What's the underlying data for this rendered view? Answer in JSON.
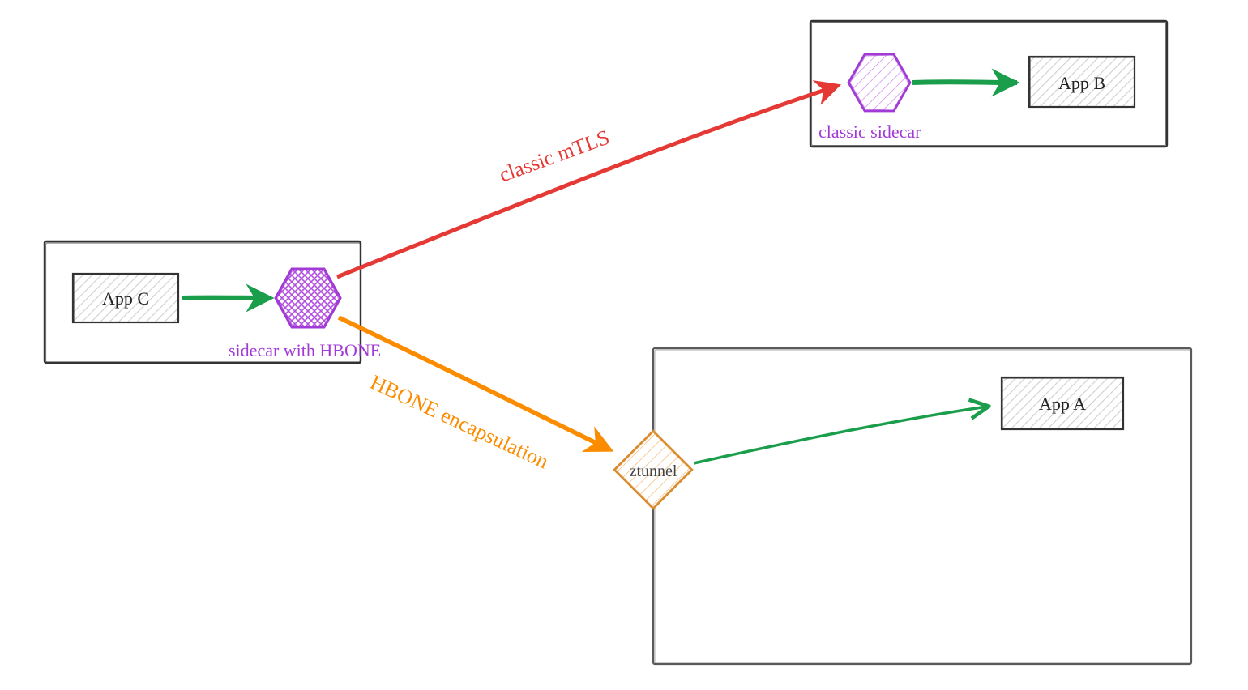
{
  "nodes": {
    "app_c": {
      "label": "App C"
    },
    "app_b": {
      "label": "App B"
    },
    "app_a": {
      "label": "App A"
    },
    "sidecar_hbone": {
      "label": "sidecar with HBONE"
    },
    "classic_sidecar": {
      "label": "classic sidecar"
    },
    "ztunnel": {
      "label": "ztunnel"
    }
  },
  "edges": {
    "classic_mtls": {
      "label": "classic mTLS"
    },
    "hbone_encap": {
      "label": "HBONE encapsulation"
    }
  },
  "colors": {
    "red": "#e53935",
    "orange": "#fb8c00",
    "green": "#1b9e4b",
    "purple": "#a23bd6",
    "box": "#333333",
    "hatch": "#bdbdbd"
  }
}
